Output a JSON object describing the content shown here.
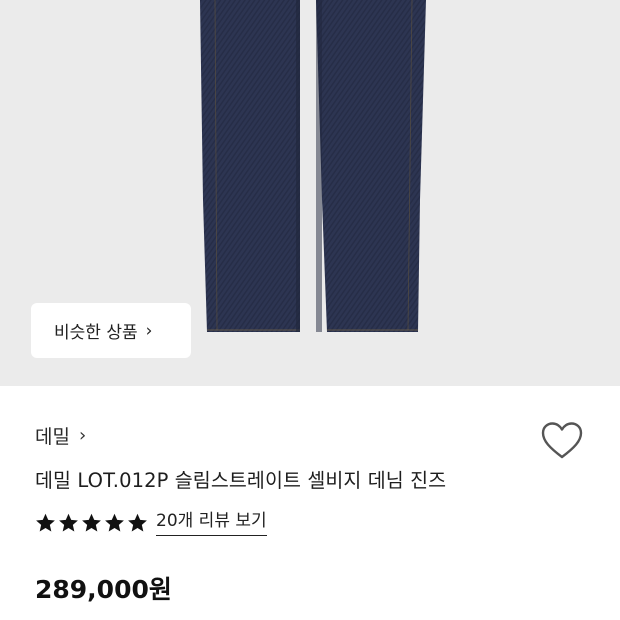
{
  "hero": {
    "image": "jeans-product-photo",
    "similar_button_label": "비슷한 상품",
    "chevron": "›"
  },
  "product": {
    "category": "데밀",
    "category_chevron": "›",
    "title": "데밀 LOT.012P 슬림스트레이트 셀비지 데님 진즈",
    "rating_stars": 5,
    "review_link": "20개 리뷰 보기",
    "price": "289,000원"
  },
  "icons": {
    "wishlist": "heart-outline-icon",
    "star": "star-icon"
  },
  "colors": {
    "hero_background": "#ebebeb",
    "denim": "#2b3350",
    "text": "#1a1a1a"
  }
}
